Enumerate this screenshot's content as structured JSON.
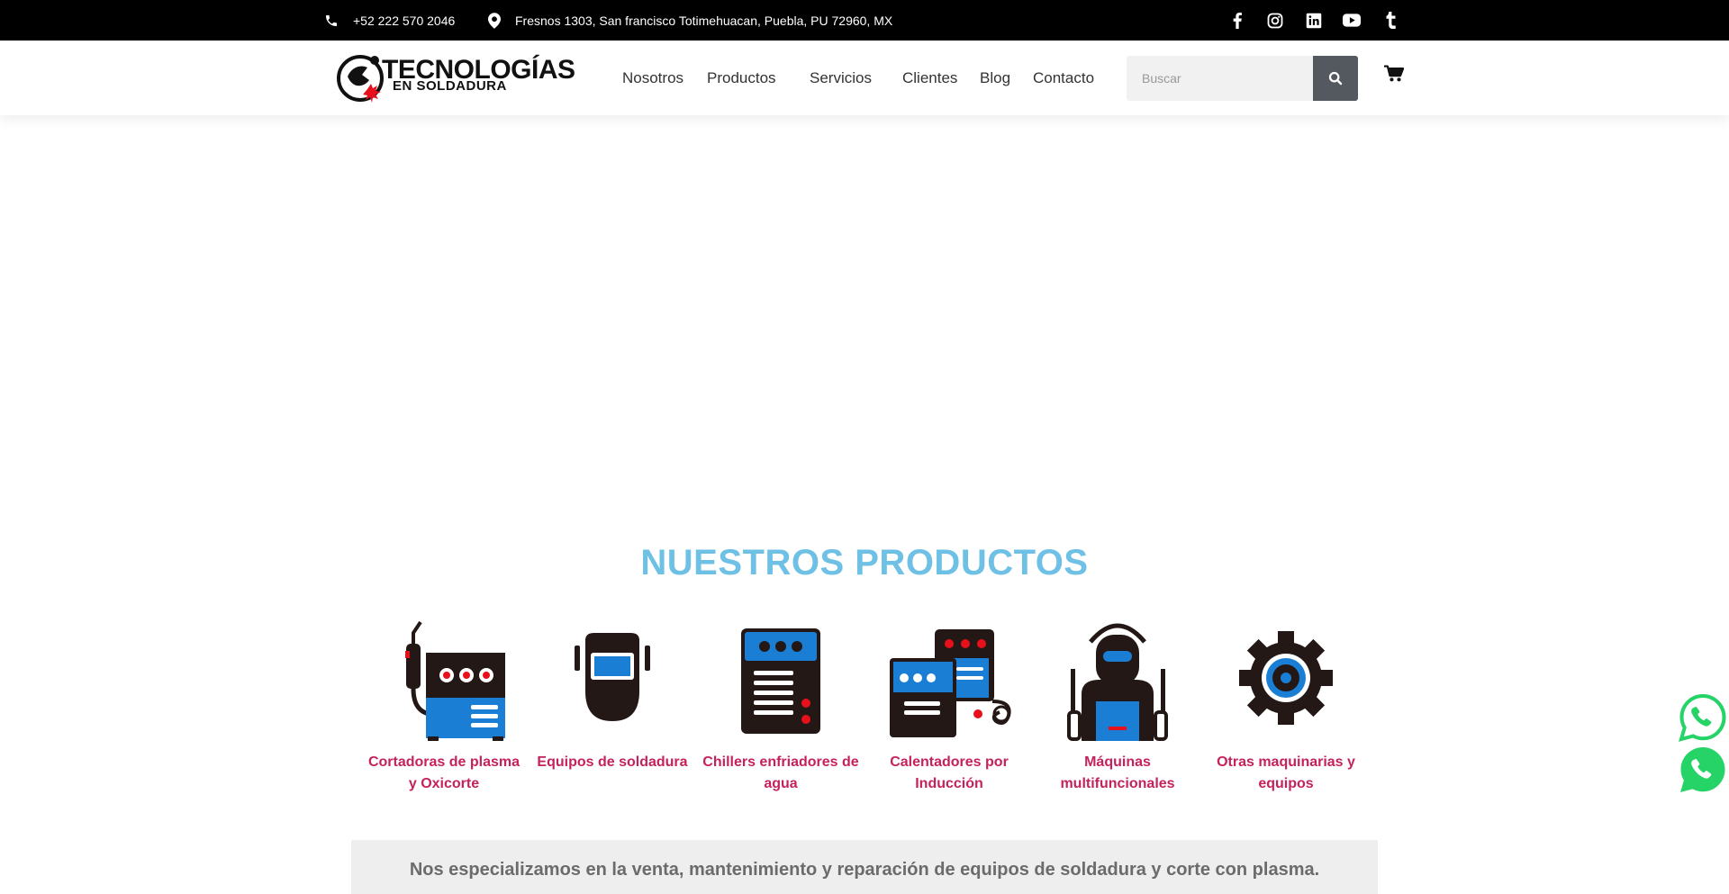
{
  "topbar": {
    "phone": "+52 222 570 2046",
    "address": "Fresnos 1303, San francisco Totimehuacan, Puebla, PU 72960, MX",
    "social_icons": [
      "facebook-icon",
      "instagram-icon",
      "linkedin-icon",
      "youtube-icon",
      "tumblr-icon"
    ]
  },
  "header": {
    "logo_line1": "TECNOLOGÍAS",
    "logo_line2": "EN SOLDADURA",
    "nav": [
      {
        "label": "Nosotros"
      },
      {
        "label": "Productos"
      },
      {
        "label": "Servicios"
      },
      {
        "label": "Clientes"
      },
      {
        "label": "Blog"
      },
      {
        "label": "Contacto"
      }
    ],
    "search_placeholder": "Buscar"
  },
  "products_section": {
    "title": "NUESTROS PRODUCTOS",
    "items": [
      {
        "line1": "Cortadoras de plasma",
        "line2": "y Oxicorte",
        "icon": "plasma-cutter-icon"
      },
      {
        "line1": "Equipos de soldadura",
        "line2": "",
        "icon": "welding-mask-icon"
      },
      {
        "line1": "Chillers enfriadores de",
        "line2": "agua",
        "icon": "chiller-icon"
      },
      {
        "line1": "Calentadores por",
        "line2": "Inducción",
        "icon": "induction-heater-icon"
      },
      {
        "line1": "Máquinas",
        "line2": "multifuncionales",
        "icon": "welder-person-icon"
      },
      {
        "line1": "Otras maquinarias y",
        "line2": "equipos",
        "icon": "gear-icon"
      }
    ],
    "banner_text": "Nos especializamos en la venta, mantenimiento y reparación de equipos de soldadura y corte con plasma."
  },
  "colors": {
    "topbar_bg": "#000000",
    "title": "#6ec1e4",
    "product_label": "#c5225d",
    "icon_blue": "#1a7fd4",
    "icon_dark": "#231815",
    "icon_red": "#e8101a",
    "whatsapp": "#25d366"
  }
}
